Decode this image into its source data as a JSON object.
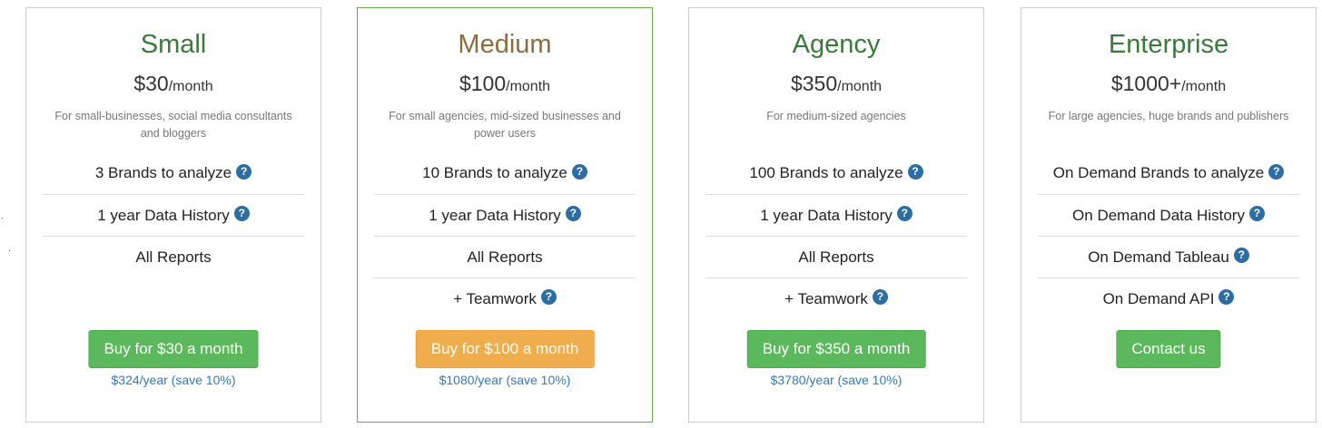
{
  "plans": [
    {
      "title": "Small",
      "price_amount": "$30",
      "price_period": "/month",
      "description": "For small-businesses, social media consultants and bloggers",
      "features": [
        {
          "label": "3 Brands to analyze",
          "help": true
        },
        {
          "label": "1 year Data History",
          "help": true
        },
        {
          "label": "All Reports",
          "help": false
        }
      ],
      "button_label": "Buy for $30 a month",
      "button_color": "#5cb85c",
      "yearly_label": "$324/year (save 10%)"
    },
    {
      "title": "Medium",
      "price_amount": "$100",
      "price_period": "/month",
      "description": "For small agencies, mid-sized businesses and power users",
      "features": [
        {
          "label": "10 Brands to analyze",
          "help": true
        },
        {
          "label": "1 year Data History",
          "help": true
        },
        {
          "label": "All Reports",
          "help": false
        },
        {
          "label": "+ Teamwork",
          "help": true
        }
      ],
      "button_label": "Buy for $100 a month",
      "button_color": "#f0ad4e",
      "yearly_label": "$1080/year (save 10%)",
      "featured": true
    },
    {
      "title": "Agency",
      "price_amount": "$350",
      "price_period": "/month",
      "description": "For medium-sized agencies",
      "features": [
        {
          "label": "100 Brands to analyze",
          "help": true
        },
        {
          "label": "1 year Data History",
          "help": true
        },
        {
          "label": "All Reports",
          "help": false
        },
        {
          "label": "+ Teamwork",
          "help": true
        }
      ],
      "button_label": "Buy for $350 a month",
      "button_color": "#5cb85c",
      "yearly_label": "$3780/year (save 10%)"
    },
    {
      "title": "Enterprise",
      "price_amount": "$1000+",
      "price_period": "/month",
      "description": "For large agencies, huge brands and publishers",
      "features": [
        {
          "label": "On Demand Brands to analyze",
          "help": true
        },
        {
          "label": "On Demand Data History",
          "help": true
        },
        {
          "label": "On Demand Tableau",
          "help": true
        },
        {
          "label": "On Demand API",
          "help": true
        }
      ],
      "button_label": "Contact us",
      "button_color": "#5cb85c",
      "yearly_label": ""
    }
  ],
  "help_icon": {
    "name": "question-circle-icon",
    "glyph": "?",
    "color": "#2e6da4"
  },
  "colors": {
    "title_green": "#3a7a3a",
    "title_featured": "#8a6d3b",
    "featured_border": "#6aa84f",
    "link": "#337ab7"
  }
}
